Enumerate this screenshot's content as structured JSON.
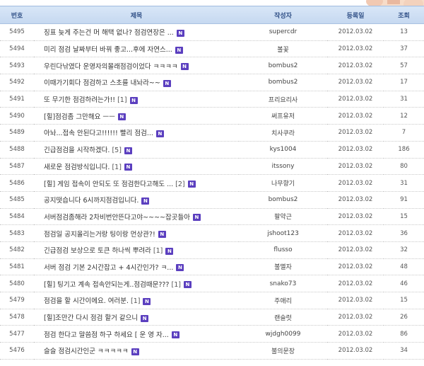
{
  "header": {
    "num": "번호",
    "title": "제목",
    "writer": "작성자",
    "date": "등록일",
    "views": "조회"
  },
  "badge_label": "N",
  "rows": [
    {
      "num": "5495",
      "title": "징표 늦게 주는건 머 해택 없나? 점검연장은 ...",
      "comments": "",
      "writer": "supercdr",
      "date": "2012.03.02",
      "views": "13"
    },
    {
      "num": "5494",
      "title": "미리 점검 날짜부터 바꿔 좋고...후에 자연스...",
      "comments": "",
      "writer": "볼꽃",
      "date": "2012.03.02",
      "views": "37"
    },
    {
      "num": "5493",
      "title": "우린다낚였다 운영자의몰래점검이었다 ㅋㅋㅋㅋ",
      "comments": "",
      "writer": "bombus2",
      "date": "2012.03.02",
      "views": "57"
    },
    {
      "num": "5492",
      "title": "이때가기회다 점검하고 스초를 내놔라~~",
      "comments": "",
      "writer": "bombus2",
      "date": "2012.03.02",
      "views": "17"
    },
    {
      "num": "5491",
      "title": "또 무기한 점검하려는가!!",
      "comments": "[1]",
      "writer": "프리요리사",
      "date": "2012.03.02",
      "views": "31"
    },
    {
      "num": "5490",
      "title": "[힐]점검좀 그만해요 ㅡㅡ",
      "comments": "",
      "writer": "써프유저",
      "date": "2012.03.02",
      "views": "12"
    },
    {
      "num": "5489",
      "title": "아놔...접속 안된다고!!!!!! 빨리 점검...",
      "comments": "",
      "writer": "치사쿠라",
      "date": "2012.03.02",
      "views": "7"
    },
    {
      "num": "5488",
      "title": "긴급점검을 시작하겠다.",
      "comments": "[5]",
      "writer": "kys1004",
      "date": "2012.03.02",
      "views": "186"
    },
    {
      "num": "5487",
      "title": "새로운 점검방식입니다.",
      "comments": "[1]",
      "writer": "itssony",
      "date": "2012.03.02",
      "views": "80"
    },
    {
      "num": "5486",
      "title": "[힐] 게임 접속이 안되도 또 점검한다고해도 ...",
      "comments": "[2]",
      "writer": "나무향기",
      "date": "2012.03.02",
      "views": "31"
    },
    {
      "num": "5485",
      "title": "공지떳습니다 6시까지점검입니다.",
      "comments": "",
      "writer": "bombus2",
      "date": "2012.03.02",
      "views": "91"
    },
    {
      "num": "5484",
      "title": "서버점검좀해라 2차비번안뜬다고야~~~~잡곳들아",
      "comments": "",
      "writer": "팔약근",
      "date": "2012.03.02",
      "views": "15"
    },
    {
      "num": "5483",
      "title": "점검일 공지올리는거랑 팅이랑 먼상관?!",
      "comments": "",
      "writer": "jshoot123",
      "date": "2012.03.02",
      "views": "36"
    },
    {
      "num": "5482",
      "title": "긴급점검 보상으로 토큰 하나씩 뿌려라",
      "comments": "[1]",
      "writer": "flusso",
      "date": "2012.03.02",
      "views": "32"
    },
    {
      "num": "5481",
      "title": "서버 점검 기본 2시간잡고 + 4시간인가? ㅋ...",
      "comments": "",
      "writer": "불멸자",
      "date": "2012.03.02",
      "views": "48"
    },
    {
      "num": "5480",
      "title": "[힐] 팅기고 계속 접속안되는게..점검때문???",
      "comments": "[1]",
      "writer": "snako73",
      "date": "2012.03.02",
      "views": "46"
    },
    {
      "num": "5479",
      "title": "점검을 할 시간이에요. 여러분.",
      "comments": "[1]",
      "writer": "주애리",
      "date": "2012.03.02",
      "views": "15"
    },
    {
      "num": "5478",
      "title": "[힐]조만간 다시 점검 할거 같으니",
      "comments": "",
      "writer": "랜슬럿",
      "date": "2012.03.02",
      "views": "26"
    },
    {
      "num": "5477",
      "title": "점검 한다고 말씀점 하구 하세요 [ 운 영 자...",
      "comments": "",
      "writer": "wjdgh0099",
      "date": "2012.03.02",
      "views": "86"
    },
    {
      "num": "5476",
      "title": "슬슬 점검시간인군 ㅋㅋㅋㅋㅋ",
      "comments": "",
      "writer": "불의문장",
      "date": "2012.03.02",
      "views": "34"
    }
  ]
}
